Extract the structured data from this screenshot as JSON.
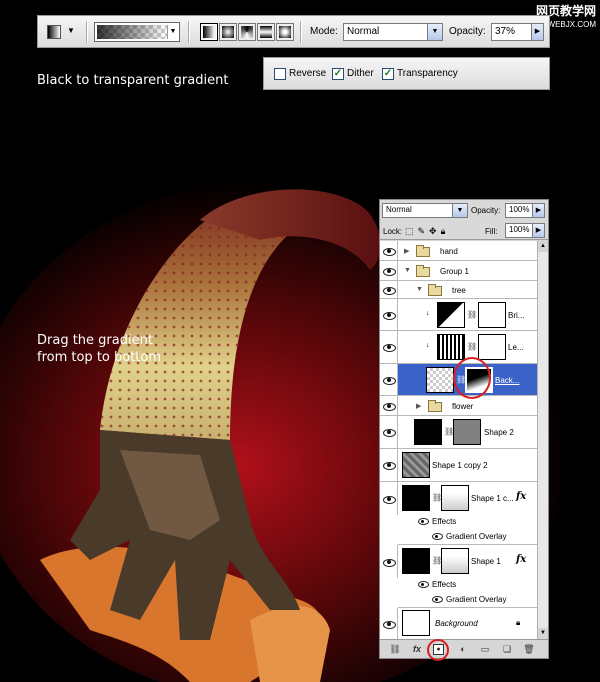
{
  "options_bar": {
    "mode_label": "Mode:",
    "mode_value": "Normal",
    "opacity_label": "Opacity:",
    "opacity_value": "37%"
  },
  "checkboxes": [
    {
      "label": "Reverse",
      "checked": false
    },
    {
      "label": "Dither",
      "checked": true
    },
    {
      "label": "Transparency",
      "checked": true
    }
  ],
  "captions": {
    "top": "Black to transparent gradient",
    "drag_line1": "Drag the gradient",
    "drag_line2": "from top to bottom"
  },
  "watermark": {
    "line1": "网页教学网",
    "line2": "WWW.WEBJX.COM"
  },
  "layers_panel": {
    "blend_mode": "Normal",
    "opacity_label": "Opacity:",
    "opacity_value": "100%",
    "lock_label": "Lock:",
    "fill_label": "Fill:",
    "fill_value": "100%",
    "layers": [
      {
        "name": "hand",
        "kind": "group"
      },
      {
        "name": "Group 1",
        "kind": "group"
      },
      {
        "name": "tree",
        "kind": "group"
      },
      {
        "name": "Bri...",
        "kind": "adjustment"
      },
      {
        "name": "Le...",
        "kind": "adjustment"
      },
      {
        "name": "Back...",
        "kind": "masked",
        "selected": true
      },
      {
        "name": "flower",
        "kind": "group"
      },
      {
        "name": "Shape 2",
        "kind": "shape"
      },
      {
        "name": "Shape 1 copy 2",
        "kind": "pixel"
      },
      {
        "name": "Shape 1 c...",
        "kind": "shape",
        "effects_label": "Effects",
        "effect": "Gradient Overlay"
      },
      {
        "name": "Shape 1",
        "kind": "shape",
        "effects_label": "Effects",
        "effect": "Gradient Overlay"
      },
      {
        "name": "Background",
        "kind": "background"
      }
    ]
  },
  "colors": {
    "selected_row": "#3a62c9",
    "highlight_ring": "#d81e1e"
  }
}
